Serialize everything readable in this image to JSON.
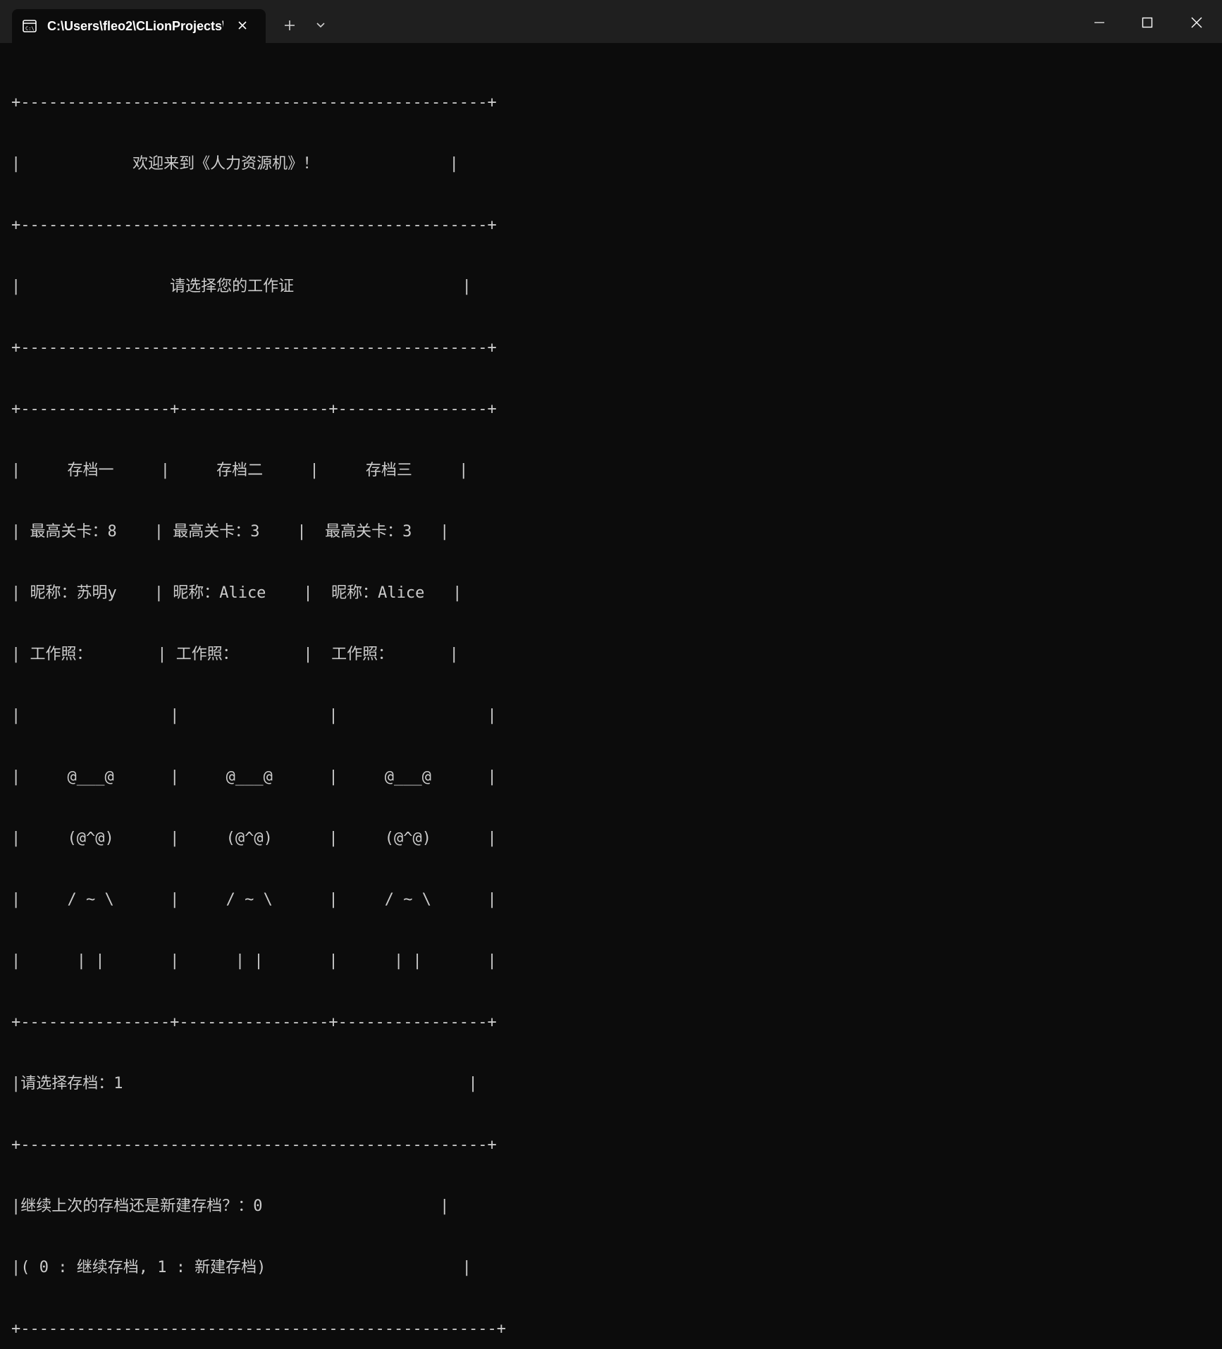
{
  "window": {
    "tab_title": "C:\\Users\\fleo2\\CLionProjects\\",
    "tab_icon": "console-icon",
    "close_tab_icon": "close-icon",
    "new_tab_icon": "plus-icon",
    "dropdown_icon": "chevron-down-icon",
    "minimize_icon": "minimize-icon",
    "maximize_icon": "maximize-icon",
    "close_window_icon": "close-icon"
  },
  "colors": {
    "background": "#0c0c0c",
    "titlebar": "#1f1f1f",
    "text": "#cccccc"
  },
  "terminal": {
    "lines": [
      "+--------------------------------------------------+",
      "|            欢迎来到《人力资源机》！              |",
      "+--------------------------------------------------+",
      "|                请选择您的工作证                  |",
      "+--------------------------------------------------+",
      "+----------------+----------------+----------------+",
      "|     存档一     |     存档二     |     存档三     |",
      "| 最高关卡：8    | 最高关卡：3    |  最高关卡：3   |",
      "| 昵称：苏明y    | 昵称：Alice    |  昵称：Alice   |",
      "| 工作照：       | 工作照：       |  工作照：      |",
      "|                |                |                |",
      "|     @___@      |     @___@      |     @___@      |",
      "|     (@^@)      |     (@^@)      |     (@^@)      |",
      "|     / ~ \\      |     / ~ \\      |     / ~ \\      |",
      "|      | |       |      | |       |      | |       |",
      "+----------------+----------------+----------------+",
      "|请选择存档：1                                     |",
      "+--------------------------------------------------+",
      "|继续上次的存档还是新建存档？：0                   |",
      "|( 0 : 继续存档, 1 : 新建存档)                     |",
      "+---------------------------------------------------+"
    ]
  }
}
